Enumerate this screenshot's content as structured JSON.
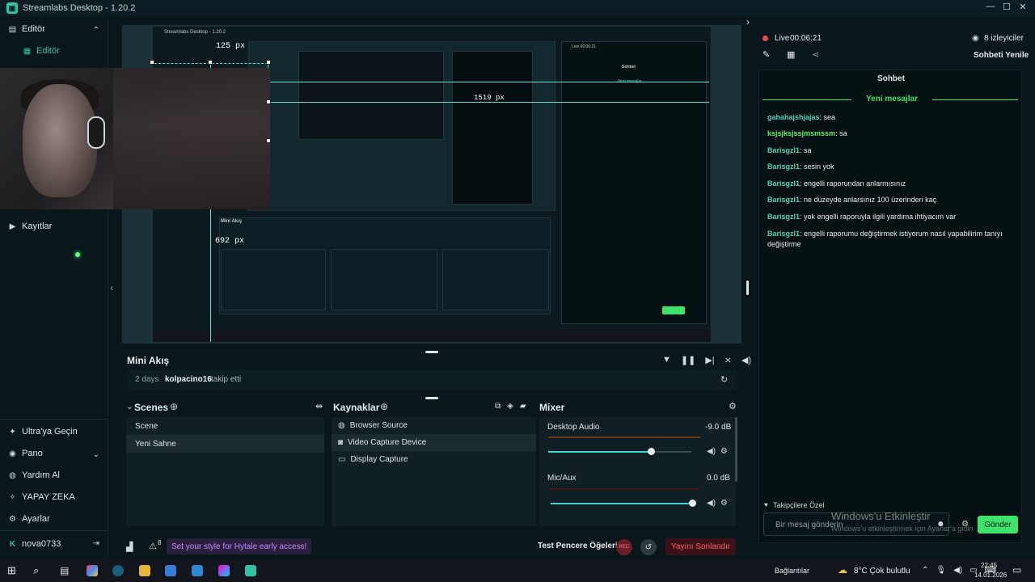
{
  "window": {
    "title": "Streamlabs Desktop - 1.20.2",
    "minimize": "—",
    "maximize": "☐",
    "close": "✕"
  },
  "nav": {
    "editor_section": "Editör",
    "editor_item": "Editör",
    "recordings": "Kayıtlar",
    "ultra": "Ultra'ya Geçin",
    "dashboard": "Pano",
    "help": "Yardım Al",
    "ai": "YAPAY ZEKA",
    "settings": "Ayarlar",
    "user": "nova0733"
  },
  "preview": {
    "guide_label_top": "125 px",
    "guide_label_right": "1519 px",
    "guide_label_bottom": "692 px",
    "nested_title": "Streamlabs Desktop - 1.20.2",
    "nested_live": "Live 00:06:21",
    "nested_chat_title": "Sohbet",
    "nested_new_messages": "Yeni mesajlar"
  },
  "mini_feed": {
    "title": "Mini Akış",
    "time": "2 days",
    "user": "kolpacino16",
    "action": "takip etti"
  },
  "scenes": {
    "title": "Scenes",
    "items": [
      "Scene",
      "Yeni Sahne"
    ],
    "selected": 1
  },
  "sources": {
    "title": "Kaynaklar",
    "items": [
      "Browser Source",
      "Video Capture Device",
      "Display Capture"
    ],
    "selected": 1
  },
  "mixer": {
    "title": "Mixer",
    "channels": [
      {
        "name": "Desktop Audio",
        "db": "-9.0 dB",
        "level": 0.72
      },
      {
        "name": "Mic/Aux",
        "db": "0.0 dB",
        "level": 1.0
      }
    ]
  },
  "footer": {
    "promo": "Set your style for Hytale early access!",
    "notif_count": "8",
    "test_label": "Test Pencere Öğeleri",
    "rec_label": "REC",
    "end_stream": "Yayını Sonlandır"
  },
  "chat": {
    "live_label": "Live",
    "live_time": "00:06:21",
    "viewers": "8 izleyiciler",
    "refresh": "Sohbeti Yenile",
    "header": "Sohbet",
    "new_messages": "Yeni mesajlar",
    "messages": [
      {
        "user": "gahahajshjajas",
        "text": ": sea"
      },
      {
        "user": "ksjsjksjssjmsmssm",
        "text": ": sa"
      },
      {
        "user": "Barisgzl1",
        "text": ": sa"
      },
      {
        "user": "Barisgzl1",
        "text": ": sesin yok"
      },
      {
        "user": "Barisgzl1",
        "text": ": engelli raporundan anlarmısınız"
      },
      {
        "user": "Barisgzl1",
        "text": ": ne düzeyde anlarsınız 100 üzerinden kaç"
      },
      {
        "user": "Barisgzl1",
        "text": ": yok engelli raporuyla ilgili yardıma ihtiyacım var"
      },
      {
        "user": "Barisgzl1",
        "text": ": engelli raporumu değiştirmek istiyorum nasıl yapabilirim tanıyı değiştirme"
      }
    ],
    "followers_only": "Takipçilere Özel",
    "input_placeholder": "Bir mesaj gönderin",
    "send": "Gönder",
    "watermark_title": "Windows'u Etkinleştir",
    "watermark_sub": "Windows'u etkinleştirmek için Ayarlar'a gidin"
  },
  "taskbar": {
    "connections": "Bağlantılar",
    "weather": "8°C  Çok bulutlu",
    "time": "22:45",
    "date": "14.01.2026"
  }
}
